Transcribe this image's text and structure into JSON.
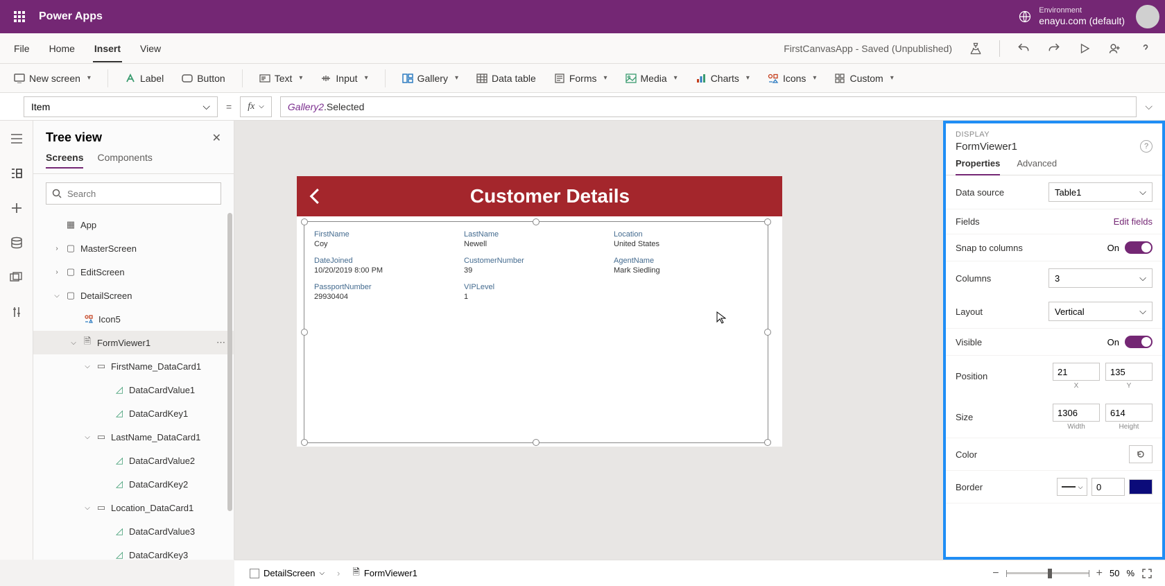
{
  "header": {
    "appname": "Power Apps",
    "env_label": "Environment",
    "env_name": "enayu.com (default)"
  },
  "menubar": {
    "items": [
      "File",
      "Home",
      "Insert",
      "View"
    ],
    "active_index": 2,
    "app_status": "FirstCanvasApp - Saved (Unpublished)"
  },
  "ribbon": {
    "new_screen": "New screen",
    "label": "Label",
    "button": "Button",
    "text": "Text",
    "input": "Input",
    "gallery": "Gallery",
    "datatable": "Data table",
    "forms": "Forms",
    "media": "Media",
    "charts": "Charts",
    "icons": "Icons",
    "custom": "Custom"
  },
  "formula": {
    "property": "Item",
    "fx": "fx",
    "gallery": "Gallery2",
    "selected": ".Selected"
  },
  "tree": {
    "title": "Tree view",
    "tabs": [
      "Screens",
      "Components"
    ],
    "search_placeholder": "Search",
    "app": "App",
    "screens": {
      "master": "MasterScreen",
      "edit": "EditScreen",
      "detail": "DetailScreen"
    },
    "icon5": "Icon5",
    "formviewer": "FormViewer1",
    "cards": {
      "firstname": "FirstName_DataCard1",
      "firstname_val": "DataCardValue1",
      "firstname_key": "DataCardKey1",
      "lastname": "LastName_DataCard1",
      "lastname_val": "DataCardValue2",
      "lastname_key": "DataCardKey2",
      "location": "Location_DataCard1",
      "location_val": "DataCardValue3",
      "location_key": "DataCardKey3"
    }
  },
  "canvas": {
    "title": "Customer Details",
    "fields": {
      "firstname_k": "FirstName",
      "firstname_v": "Coy",
      "lastname_k": "LastName",
      "lastname_v": "Newell",
      "location_k": "Location",
      "location_v": "United States",
      "datejoined_k": "DateJoined",
      "datejoined_v": "10/20/2019 8:00 PM",
      "custnum_k": "CustomerNumber",
      "custnum_v": "39",
      "agent_k": "AgentName",
      "agent_v": "Mark Siedling",
      "passport_k": "PassportNumber",
      "passport_v": "29930404",
      "vip_k": "VIPLevel",
      "vip_v": "1"
    }
  },
  "props": {
    "category": "DISPLAY",
    "element": "FormViewer1",
    "tabs": [
      "Properties",
      "Advanced"
    ],
    "datasource_label": "Data source",
    "datasource_value": "Table1",
    "fields_label": "Fields",
    "fields_link": "Edit fields",
    "snap_label": "Snap to columns",
    "snap_state": "On",
    "columns_label": "Columns",
    "columns_value": "3",
    "layout_label": "Layout",
    "layout_value": "Vertical",
    "visible_label": "Visible",
    "visible_state": "On",
    "position_label": "Position",
    "position_x": "21",
    "position_y": "135",
    "x_label": "X",
    "y_label": "Y",
    "size_label": "Size",
    "size_w": "1306",
    "size_h": "614",
    "w_label": "Width",
    "h_label": "Height",
    "color_label": "Color",
    "border_label": "Border",
    "border_value": "0"
  },
  "status": {
    "screen": "DetailScreen",
    "element": "FormViewer1",
    "zoom": "50",
    "zoom_pct": "%"
  }
}
